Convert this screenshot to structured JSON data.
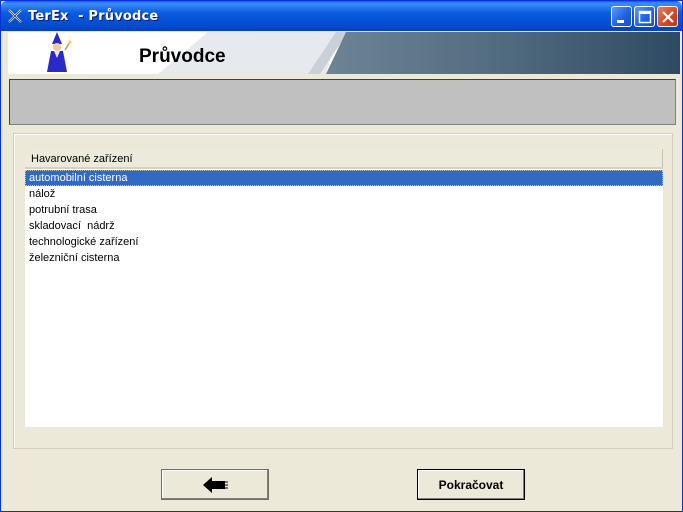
{
  "window": {
    "title": "TerEx  - Průvodce"
  },
  "header": {
    "title": "Průvodce"
  },
  "list": {
    "column_header": "Havarované zařízení",
    "items": [
      "automobilní cisterna",
      "nálož",
      "potrubní trasa",
      "skladovací  nádrž",
      "technologické zařízení",
      "železniční cisterna"
    ],
    "selected_index": 0
  },
  "buttons": {
    "back_icon": "arrow-left-icon",
    "next_label": "Pokračovat"
  },
  "colors": {
    "titlebar": "#0A5BE0",
    "selection": "#316AC5",
    "panel": "#C0C0C0",
    "window_bg": "#ECE9D8"
  }
}
